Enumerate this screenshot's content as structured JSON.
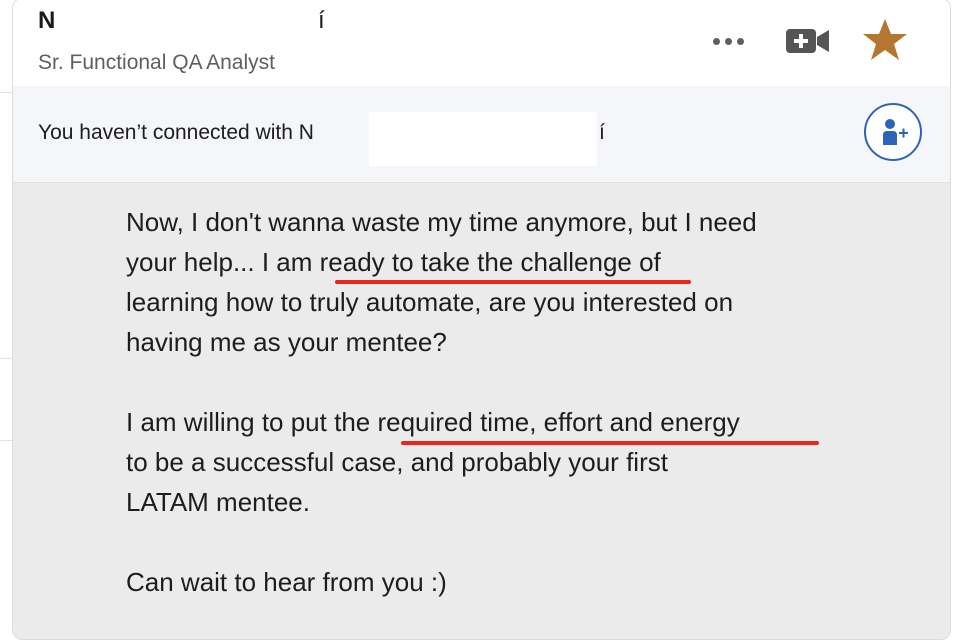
{
  "header": {
    "name_start": "N",
    "name_end": "í",
    "subtitle": "Sr. Functional QA Analyst"
  },
  "actions": {
    "more_icon": "ellipsis-icon",
    "video_icon": "video-call-icon",
    "star_icon": "star-icon",
    "star_color": "#b5762f"
  },
  "connection": {
    "message_prefix": "You haven’t connected with N",
    "message_suffix": "í",
    "connect_icon": "add-connection-icon",
    "accent": "#2e63ba"
  },
  "message": {
    "lines": [
      "Now, I don't wanna waste my time anymore, but I need",
      "your help... I am ready to take the challenge of",
      "learning how to truly automate, are you interested on",
      "having me as your mentee?",
      "",
      "I am willing to put the required time, effort and energy",
      "to be a successful case, and probably your first",
      "LATAM mentee.",
      "",
      "Can wait to hear from you :)"
    ],
    "highlight_color": "#e8251e"
  }
}
